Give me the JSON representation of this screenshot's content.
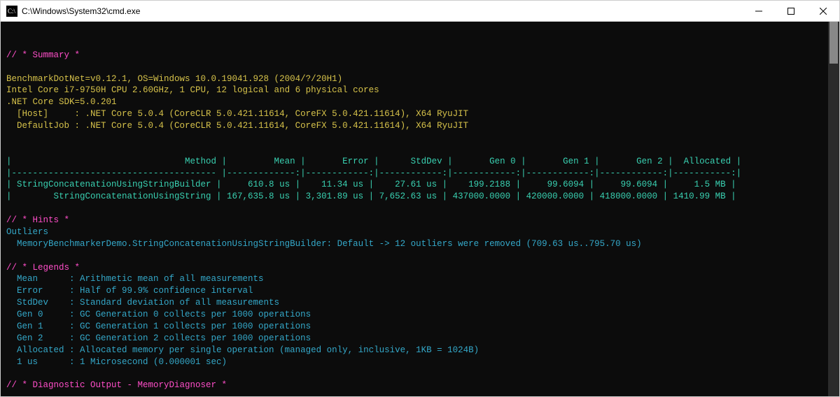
{
  "window": {
    "title": "C:\\Windows\\System32\\cmd.exe"
  },
  "sections": {
    "summary_header": "// * Summary *",
    "hints_header": "// * Hints *",
    "legends_header": "// * Legends *",
    "diag_header": "// * Diagnostic Output - MemoryDiagnoser *"
  },
  "env": {
    "line1": "BenchmarkDotNet=v0.12.1, OS=Windows 10.0.19041.928 (2004/?/20H1)",
    "line2": "Intel Core i7-9750H CPU 2.60GHz, 1 CPU, 12 logical and 6 physical cores",
    "line3": ".NET Core SDK=5.0.201",
    "host_label": "  [Host]     : ",
    "host_val": ".NET Core 5.0.4 (CoreCLR 5.0.421.11614, CoreFX 5.0.421.11614), X64 RyuJIT",
    "job_label": "  DefaultJob : ",
    "job_val": ".NET Core 5.0.4 (CoreCLR 5.0.421.11614, CoreFX 5.0.421.11614), X64 RyuJIT"
  },
  "table": {
    "header": "|                                 Method |         Mean |       Error |      StdDev |       Gen 0 |       Gen 1 |       Gen 2 |  Allocated |",
    "divider": "|--------------------------------------- |-------------:|------------:|------------:|------------:|------------:|------------:|-----------:|",
    "row1": "| StringConcatenationUsingStringBuilder |     610.8 us |    11.34 us |    27.61 us |    199.2188 |     99.6094 |     99.6094 |     1.5 MB |",
    "row2": "|        StringConcatenationUsingString | 167,635.8 us | 3,301.89 us | 7,652.63 us | 437000.0000 | 420000.0000 | 418000.0000 | 1410.99 MB |"
  },
  "hints": {
    "outliers_label": "Outliers",
    "outliers_line": "  MemoryBenchmarkerDemo.StringConcatenationUsingStringBuilder: Default -> 12 outliers were removed (709.63 us..795.70 us)"
  },
  "legends": {
    "mean": "  Mean      : Arithmetic mean of all measurements",
    "error": "  Error     : Half of 99.9% confidence interval",
    "stddev": "  StdDev    : Standard deviation of all measurements",
    "gen0": "  Gen 0     : GC Generation 0 collects per 1000 operations",
    "gen1": "  Gen 1     : GC Generation 1 collects per 1000 operations",
    "gen2": "  Gen 2     : GC Generation 2 collects per 1000 operations",
    "alloc": "  Allocated : Allocated memory per single operation (managed only, inclusive, 1KB = 1024B)",
    "us": "  1 us      : 1 Microsecond (0.000001 sec)"
  }
}
